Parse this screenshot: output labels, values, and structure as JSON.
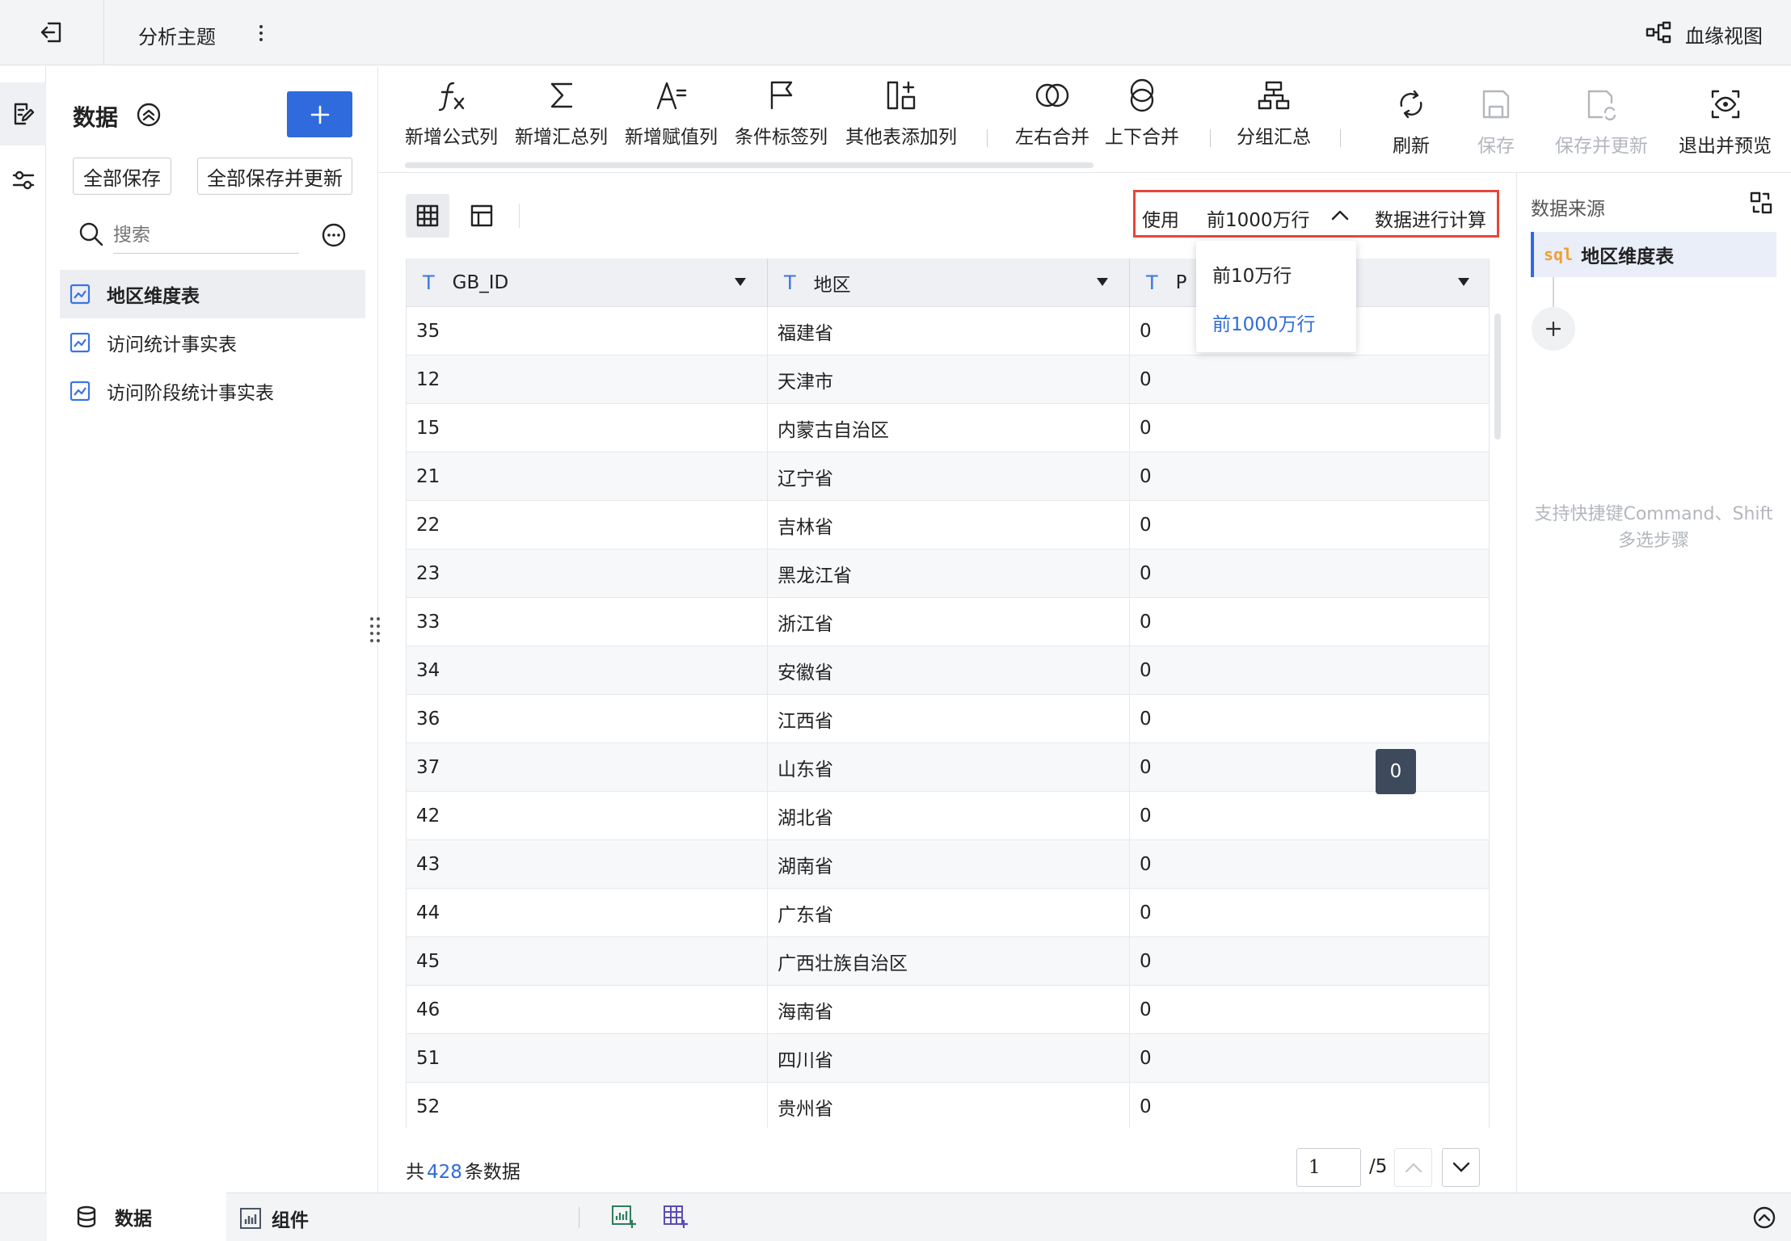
{
  "top": {
    "title": "分析主题",
    "lineage": "血缘视图"
  },
  "data_panel": {
    "title": "数据",
    "save_all": "全部保存",
    "save_all_update": "全部保存并更新",
    "search_placeholder": "搜索",
    "items": [
      "地区维度表",
      "访问统计事实表",
      "访问阶段统计事实表"
    ]
  },
  "toolbar": {
    "formula": "新增公式列",
    "summary": "新增汇总列",
    "assign": "新增赋值列",
    "tag": "条件标签列",
    "other": "其他表添加列",
    "lr_merge": "左右合并",
    "tb_merge": "上下合并",
    "group": "分组汇总",
    "refresh": "刷新",
    "save": "保存",
    "save_update": "保存并更新",
    "exit": "退出并预览"
  },
  "rows_selector": {
    "prefix": "使用",
    "value": "前1000万行",
    "suffix": "数据进行计算",
    "options": [
      "前10万行",
      "前1000万行"
    ]
  },
  "table": {
    "columns": [
      "GB_ID",
      "地区",
      "P"
    ],
    "rows": [
      [
        "35",
        "福建省",
        "0"
      ],
      [
        "12",
        "天津市",
        "0"
      ],
      [
        "15",
        "内蒙古自治区",
        "0"
      ],
      [
        "21",
        "辽宁省",
        "0"
      ],
      [
        "22",
        "吉林省",
        "0"
      ],
      [
        "23",
        "黑龙江省",
        "0"
      ],
      [
        "33",
        "浙江省",
        "0"
      ],
      [
        "34",
        "安徽省",
        "0"
      ],
      [
        "36",
        "江西省",
        "0"
      ],
      [
        "37",
        "山东省",
        "0"
      ],
      [
        "42",
        "湖北省",
        "0"
      ],
      [
        "43",
        "湖南省",
        "0"
      ],
      [
        "44",
        "广东省",
        "0"
      ],
      [
        "45",
        "广西壮族自治区",
        "0"
      ],
      [
        "46",
        "海南省",
        "0"
      ],
      [
        "51",
        "四川省",
        "0"
      ],
      [
        "52",
        "贵州省",
        "0"
      ]
    ],
    "tooltip": "0"
  },
  "pager": {
    "prefix": "共",
    "count": "428",
    "suffix": "条数据",
    "current": "1",
    "total": "/5"
  },
  "right": {
    "title": "数据来源",
    "source": "地区维度表",
    "sql_tag": "sql",
    "hint_line1": "支持快捷键Command、Shift",
    "hint_line2": "多选步骤"
  },
  "bottom": {
    "tab_data": "数据",
    "tab_component": "组件"
  },
  "colors": {
    "accent": "#2f6bdd",
    "highlight": "#e8463a",
    "icon_blue": "#3b74e4",
    "sql_orange": "#f0a030"
  }
}
